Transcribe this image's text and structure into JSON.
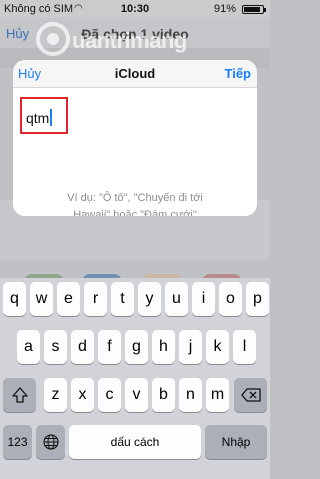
{
  "status_bar": {
    "carrier": "Không có SIM",
    "time": "10:30",
    "battery": "91%"
  },
  "background": {
    "back": "Hủy",
    "title": "Đã chọn 1 video"
  },
  "watermark": {
    "text": "uantrimang"
  },
  "dialog": {
    "cancel_label": "Hủy",
    "title": "iCloud",
    "next_label": "Tiếp",
    "input_value": "qtm",
    "hint_line1": "Ví dụ: \"Ô tô\", \"Chuyến đi tới",
    "hint_line2": "Hawaii\" hoặc \"Đám cưới\""
  },
  "keyboard": {
    "row1": [
      "q",
      "w",
      "e",
      "r",
      "t",
      "y",
      "u",
      "i",
      "o",
      "p"
    ],
    "row2": [
      "a",
      "s",
      "d",
      "f",
      "g",
      "h",
      "j",
      "k",
      "l"
    ],
    "row3": [
      "z",
      "x",
      "c",
      "v",
      "b",
      "n",
      "m"
    ],
    "numbers_label": "123",
    "space_label": "dấu cách",
    "return_label": "Nhập",
    "icons": {
      "shift": "shift-icon",
      "delete": "delete-icon",
      "globe": "globe-icon"
    }
  }
}
